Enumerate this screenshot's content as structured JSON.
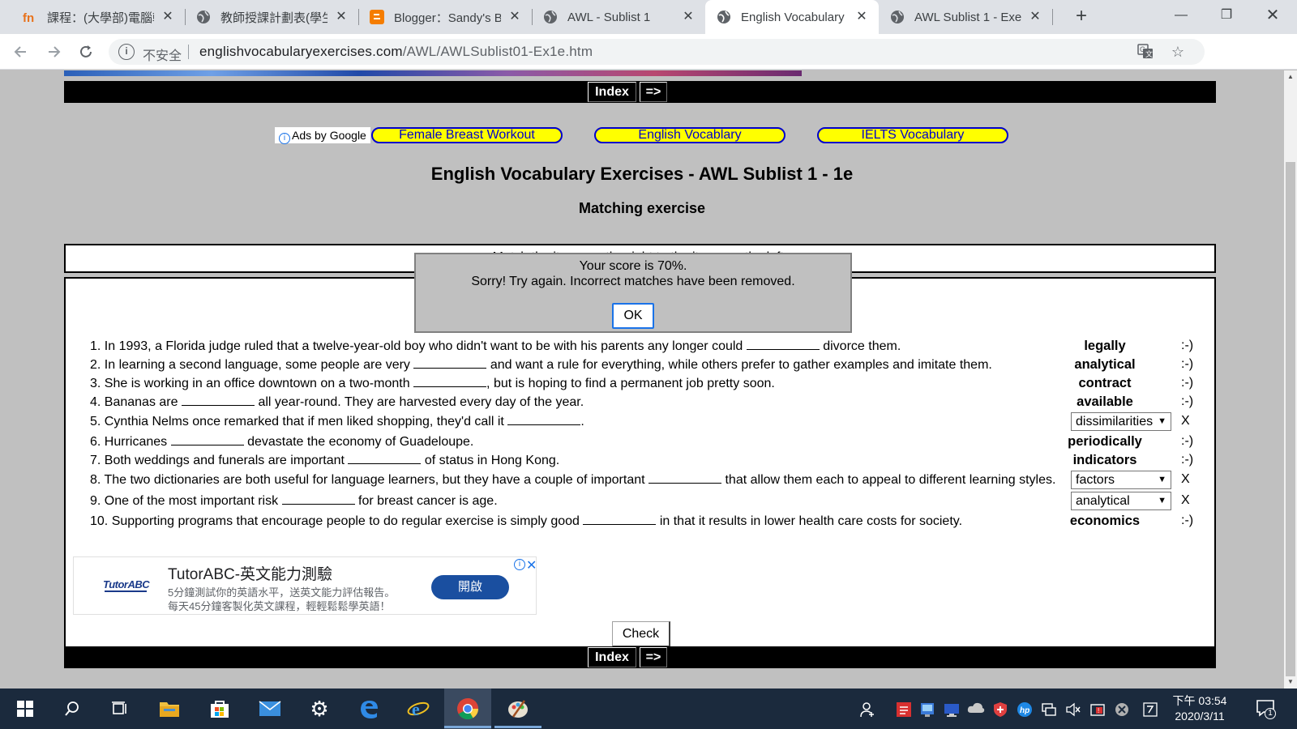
{
  "browser": {
    "tabs": [
      {
        "title": "課程：(大學部)電腦輔",
        "icon": "tronclass-icon"
      },
      {
        "title": "教師授課計劃表(學生",
        "icon": "globe-icon"
      },
      {
        "title": "Blogger：Sandy's B",
        "icon": "blogger-icon"
      },
      {
        "title": "AWL - Sublist 1",
        "icon": "globe-icon"
      },
      {
        "title": "English Vocabulary",
        "icon": "globe-icon",
        "active": true
      },
      {
        "title": "AWL Sublist 1 - Exe",
        "icon": "globe-icon"
      }
    ],
    "insecure_label": "不安全",
    "url_host": "englishvocabularyexercises.com",
    "url_path": "/AWL/AWLSublist01-Ex1e.htm"
  },
  "page": {
    "nav": {
      "index_label": "Index",
      "next_label": "=>"
    },
    "ads_by": "Ads by Google",
    "ad_links": [
      "Female Breast Workout",
      "English Vocablary",
      "IELTS Vocabulary"
    ],
    "title": "English Vocabulary Exercises - AWL Sublist 1 - 1e",
    "subtitle": "Matching exercise",
    "instructions": "Match the items on the right to the items on the left.",
    "questions": [
      {
        "pre": "1. In 1993, a Florida judge ruled that a twelve-year-old boy who didn't want to be with his parents any longer could",
        "post": "divorce them.",
        "answer": "legally",
        "mark": ":-)"
      },
      {
        "pre": "2. In learning a second language, some people are very",
        "post": "and want a rule for everything, while others prefer to gather examples and imitate them.",
        "answer": "analytical",
        "mark": ":-)"
      },
      {
        "pre": "3. She is working in an office downtown on a two-month",
        "post": ", but is hoping to find a permanent job pretty soon.",
        "answer": "contract",
        "mark": ":-)"
      },
      {
        "pre": "4. Bananas are",
        "post": "all year-round. They are harvested every day of the year.",
        "answer": "available",
        "mark": ":-)"
      },
      {
        "pre": "5. Cynthia Nelms once remarked that if men liked shopping, they'd call it",
        "post": ".",
        "select": "dissimilarities",
        "mark": "X"
      },
      {
        "pre": "6. Hurricanes",
        "post": "devastate the economy of Guadeloupe.",
        "answer": "periodically",
        "mark": ":-)"
      },
      {
        "pre": "7. Both weddings and funerals are important",
        "post": "of status in Hong Kong.",
        "answer": "indicators",
        "mark": ":-)"
      },
      {
        "pre": "8. The two dictionaries are both useful for language learners, but they have a couple of important",
        "post": "that allow them each to appeal to different learning styles.",
        "select": "factors",
        "mark": "X"
      },
      {
        "pre": "9. One of the most important risk",
        "post": "for breast cancer is age.",
        "select": "analytical",
        "mark": "X"
      },
      {
        "pre": "10. Supporting programs that encourage people to do regular exercise is simply good",
        "post": "in that it results in lower health care costs for society.",
        "answer": "economics",
        "mark": ":-)"
      }
    ],
    "ad": {
      "logo": "TutorABC",
      "title": "TutorABC-英文能力測驗",
      "line1": "5分鐘測試你的英語水平，送英文能力評估報告。",
      "line2": "每天45分鐘客製化英文課程，輕輕鬆鬆學英語！",
      "button": "開啟"
    },
    "check_label": "Check"
  },
  "dialog": {
    "line1": "Your score is 70%.",
    "line2": "Sorry! Try again. Incorrect matches have been removed.",
    "ok_label": "OK"
  },
  "taskbar": {
    "time": "下午 03:54",
    "date": "2020/3/11",
    "notification_count": "1"
  },
  "colors": {
    "ad_link_bg": "#ffff00",
    "ad_link_text": "#0000cc",
    "taskbar_bg": "#1b2a3d",
    "page_bg": "#c0c0c0"
  }
}
